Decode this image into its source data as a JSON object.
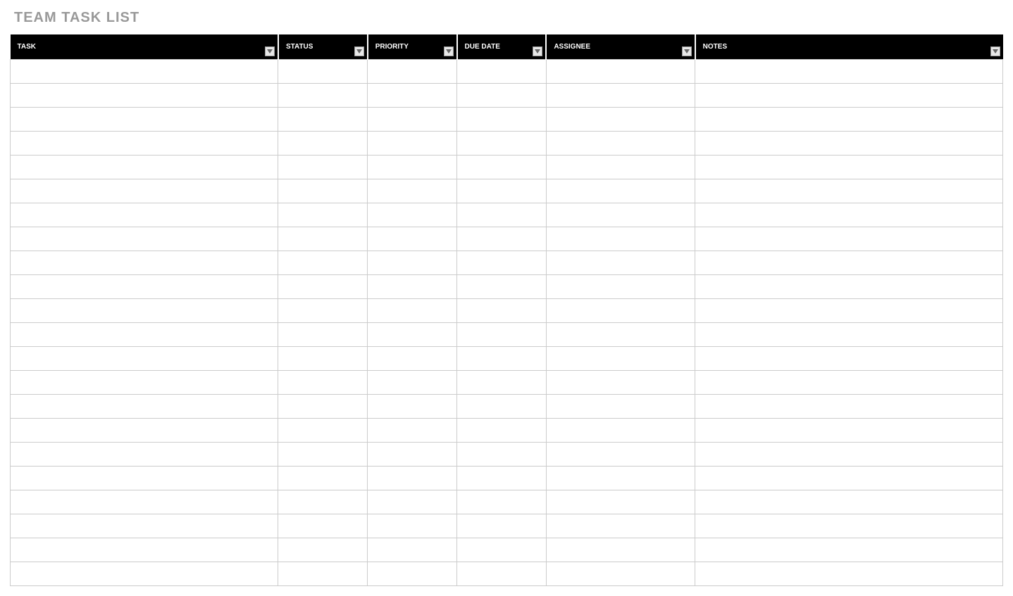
{
  "title": "TEAM TASK LIST",
  "columns": [
    {
      "label": "TASK"
    },
    {
      "label": "STATUS"
    },
    {
      "label": "PRIORITY"
    },
    {
      "label": "DUE DATE"
    },
    {
      "label": "ASSIGNEE"
    },
    {
      "label": "NOTES"
    }
  ],
  "rows": [
    {
      "task": "",
      "status": "",
      "priority": "",
      "due": "",
      "assignee": "",
      "notes": ""
    },
    {
      "task": "",
      "status": "",
      "priority": "",
      "due": "",
      "assignee": "",
      "notes": ""
    },
    {
      "task": "",
      "status": "",
      "priority": "",
      "due": "",
      "assignee": "",
      "notes": ""
    },
    {
      "task": "",
      "status": "",
      "priority": "",
      "due": "",
      "assignee": "",
      "notes": ""
    },
    {
      "task": "",
      "status": "",
      "priority": "",
      "due": "",
      "assignee": "",
      "notes": ""
    },
    {
      "task": "",
      "status": "",
      "priority": "",
      "due": "",
      "assignee": "",
      "notes": ""
    },
    {
      "task": "",
      "status": "",
      "priority": "",
      "due": "",
      "assignee": "",
      "notes": ""
    },
    {
      "task": "",
      "status": "",
      "priority": "",
      "due": "",
      "assignee": "",
      "notes": ""
    },
    {
      "task": "",
      "status": "",
      "priority": "",
      "due": "",
      "assignee": "",
      "notes": ""
    },
    {
      "task": "",
      "status": "",
      "priority": "",
      "due": "",
      "assignee": "",
      "notes": ""
    },
    {
      "task": "",
      "status": "",
      "priority": "",
      "due": "",
      "assignee": "",
      "notes": ""
    },
    {
      "task": "",
      "status": "",
      "priority": "",
      "due": "",
      "assignee": "",
      "notes": ""
    },
    {
      "task": "",
      "status": "",
      "priority": "",
      "due": "",
      "assignee": "",
      "notes": ""
    },
    {
      "task": "",
      "status": "",
      "priority": "",
      "due": "",
      "assignee": "",
      "notes": ""
    },
    {
      "task": "",
      "status": "",
      "priority": "",
      "due": "",
      "assignee": "",
      "notes": ""
    },
    {
      "task": "",
      "status": "",
      "priority": "",
      "due": "",
      "assignee": "",
      "notes": ""
    },
    {
      "task": "",
      "status": "",
      "priority": "",
      "due": "",
      "assignee": "",
      "notes": ""
    },
    {
      "task": "",
      "status": "",
      "priority": "",
      "due": "",
      "assignee": "",
      "notes": ""
    },
    {
      "task": "",
      "status": "",
      "priority": "",
      "due": "",
      "assignee": "",
      "notes": ""
    },
    {
      "task": "",
      "status": "",
      "priority": "",
      "due": "",
      "assignee": "",
      "notes": ""
    },
    {
      "task": "",
      "status": "",
      "priority": "",
      "due": "",
      "assignee": "",
      "notes": ""
    },
    {
      "task": "",
      "status": "",
      "priority": "",
      "due": "",
      "assignee": "",
      "notes": ""
    }
  ]
}
